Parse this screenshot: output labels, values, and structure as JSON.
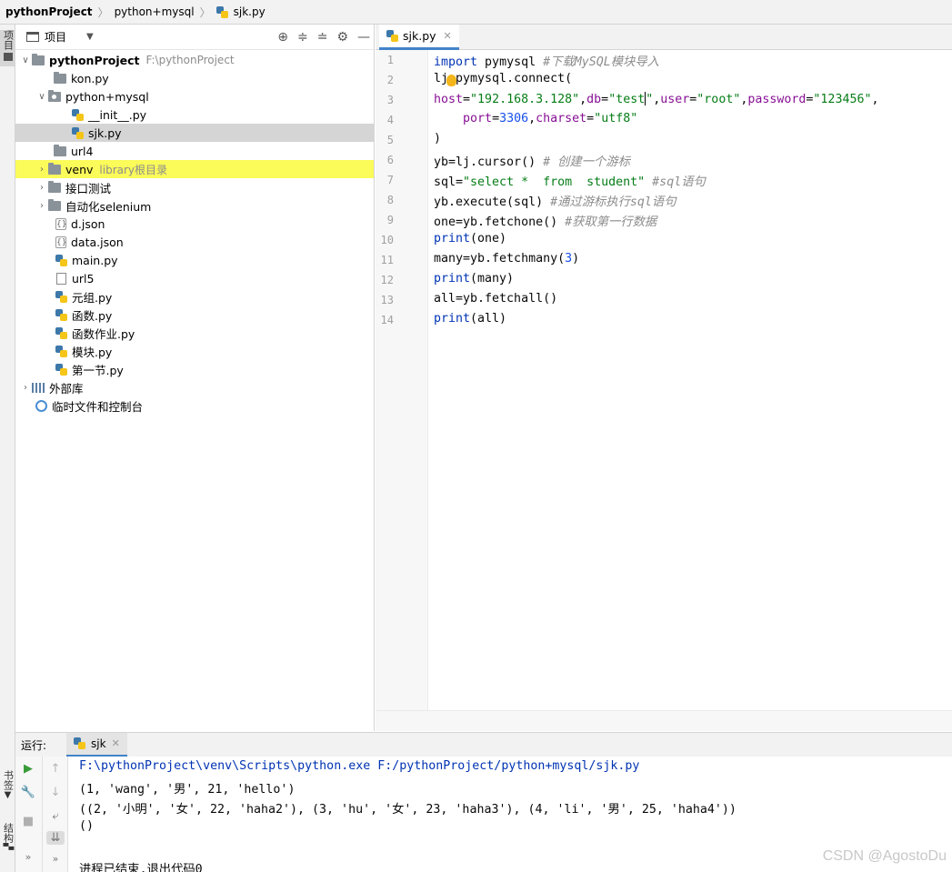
{
  "breadcrumb": {
    "project": "pythonProject",
    "folder": "python+mysql",
    "file": "sjk.py"
  },
  "left_strip": {
    "project_tab": "项目",
    "bookmarks_tab": "书签",
    "structure_tab": "结构"
  },
  "project_panel": {
    "title": "项目",
    "tree": [
      {
        "label": "pythonProject",
        "hint": "F:\\pythonProject",
        "type": "folder"
      },
      {
        "label": "kon.py",
        "type": "folder"
      },
      {
        "label": "python+mysql",
        "type": "package"
      },
      {
        "label": "__init__.py",
        "type": "py"
      },
      {
        "label": "sjk.py",
        "type": "py",
        "selected": true
      },
      {
        "label": "url4",
        "type": "folder"
      },
      {
        "label": "venv",
        "hint": "library根目录",
        "type": "folder",
        "excluded": true
      },
      {
        "label": "接口测试",
        "type": "folder"
      },
      {
        "label": "自动化selenium",
        "type": "folder"
      },
      {
        "label": "d.json",
        "type": "json"
      },
      {
        "label": "data.json",
        "type": "json"
      },
      {
        "label": "main.py",
        "type": "py"
      },
      {
        "label": "url5",
        "type": "file"
      },
      {
        "label": "元组.py",
        "type": "py"
      },
      {
        "label": "函数.py",
        "type": "py"
      },
      {
        "label": "函数作业.py",
        "type": "py"
      },
      {
        "label": "模块.py",
        "type": "py"
      },
      {
        "label": "第一节.py",
        "type": "py"
      },
      {
        "label": "外部库",
        "type": "library"
      },
      {
        "label": "临时文件和控制台",
        "type": "scratch"
      }
    ]
  },
  "editor": {
    "tab_label": "sjk.py",
    "line_numbers": [
      "1",
      "2",
      "3",
      "4",
      "5",
      "6",
      "7",
      "8",
      "9",
      "10",
      "11",
      "12",
      "13",
      "14"
    ],
    "code": {
      "l1_kw": "import",
      "l1_mod": " pymysql ",
      "l1_cmt": "#下载MySQL模块导入",
      "l2_a": "l",
      "l2_b": "j=pymysql.connect(",
      "l3_k1": "host",
      "l3_v1": "\"192.168.3.128\"",
      "l3_k2": "db",
      "l3_v2a": "\"test",
      "l3_v2b": "\"",
      "l3_k3": "user",
      "l3_v3": "\"root\"",
      "l3_k4": "password",
      "l3_v4": "\"123456\"",
      "l4_k1": "port",
      "l4_v1": "3306",
      "l4_k2": "charset",
      "l4_v2": "\"utf8\"",
      "l5": ")",
      "l6_code": "yb=lj.cursor() ",
      "l6_cmt": "# 创建一个游标",
      "l7_a": "sql=",
      "l7_str": "\"select *  from  student\"",
      "l7_cmt": " #sql语句",
      "l8_code": "yb.execute(sql) ",
      "l8_cmt": "#通过游标执行sql语句",
      "l9_code": "one=yb.fetchone() ",
      "l9_cmt": "#获取第一行数据",
      "l10_fn": "print",
      "l10_rest": "(one)",
      "l11_a": "many=yb.fetchmany(",
      "l11_num": "3",
      "l11_b": ")",
      "l12_fn": "print",
      "l12_rest": "(many)",
      "l13": "all=yb.fetchall()",
      "l14_fn": "print",
      "l14_rest": "(all)"
    }
  },
  "run_panel": {
    "label": "运行:",
    "tab_label": "sjk",
    "console": {
      "command": "F:\\pythonProject\\venv\\Scripts\\python.exe F:/pythonProject/python+mysql/sjk.py",
      "out1": "(1, 'wang', '男', 21, 'hello')",
      "out2": "((2, '小明', '女', 22, 'haha2'), (3, 'hu', '女', 23, 'haha3'), (4, 'li', '男', 25, 'haha4'))",
      "out3": "()",
      "exit": "进程已结束,退出代码0"
    }
  },
  "watermark": "CSDN @AgostoDu",
  "colors": {
    "accent": "#4083c9",
    "excluded_highlight": "#fbfb5a",
    "keyword": "#0033b3",
    "string": "#067d17",
    "comment": "#8c8c8c"
  }
}
